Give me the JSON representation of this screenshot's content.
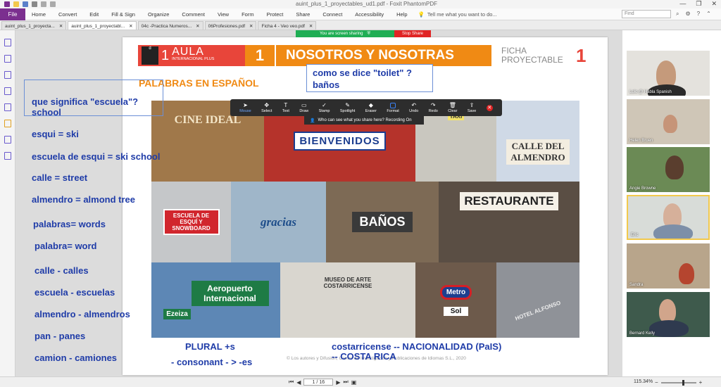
{
  "window": {
    "title": "auint_plus_1_proyectables_ud1.pdf - Foxit PhantomPDF",
    "controls": [
      "—",
      "❐",
      "✕"
    ]
  },
  "menu": {
    "file": "File",
    "items": [
      "Home",
      "Convert",
      "Edit",
      "Fill & Sign",
      "Organize",
      "Comment",
      "View",
      "Form",
      "Protect",
      "Share",
      "Connect",
      "Accessibility",
      "Help"
    ],
    "tell_me": "Tell me what you want to do...",
    "find_placeholder": "Find"
  },
  "tabs": [
    {
      "label": "auint_plus_1_proyecta...",
      "active": false
    },
    {
      "label": "auint_plus_1_proyectabl...",
      "active": true
    },
    {
      "label": "04c -Practica Numeros...",
      "active": false
    },
    {
      "label": "06Profesiones.pdf",
      "active": false
    },
    {
      "label": "Ficha 4 - Veo veo.pdf",
      "active": false
    }
  ],
  "share": {
    "status": "You are screen sharing",
    "stop_label": "Stop Share",
    "toolbar": [
      "Mouse",
      "Select",
      "Text",
      "Draw",
      "Stamp",
      "Spotlight",
      "Eraser",
      "Format",
      "Undo",
      "Redo",
      "Clear",
      "Save"
    ],
    "recording_notice": "Who can see what you share here? Recording On"
  },
  "page": {
    "banner": {
      "aula_num": "1",
      "aula_title": "AULA",
      "aula_sub": "INTERNACIONAL PLUS",
      "unit_number": "1",
      "unit_title": "NOSOTROS Y NOSOTRAS",
      "ficha_line1": "FICHA",
      "ficha_line2": "PROYECTABLE",
      "ficha_number": "1"
    },
    "section_title": "PALABRAS EN ESPAÑOL",
    "question_box": [
      "como se dice \"toilet\" ?",
      "baños"
    ],
    "footer": "© Los autores y Difusión, Centro de Investigación y Publicaciones de Idiomas S.L., 2020",
    "collage_signs": [
      "CINE IDEAL",
      "BIENVENIDOS",
      "TAXI",
      "CALLE DEL ALMENDRO",
      "ESCUELA DE ESQUÍ Y SNOWBOARD",
      "gracias",
      "BAÑOS",
      "RESTAURANTE",
      "Aeropuerto Internacional",
      "Ezeiza",
      "MUSEO DE ARTE COSTARRICENSE",
      "Metro",
      "Sol",
      "HOTEL ALFONSO"
    ]
  },
  "annotations": {
    "left": [
      "que significa \"escuela\"?",
      "school",
      "esqui = ski",
      "escuela de esqui = ski school",
      "calle = street",
      "almendro = almond tree",
      "palabras= words",
      "palabra= word",
      "calle - calles",
      "escuela - escuelas",
      "almendro - almendros",
      "pan - panes",
      "camion - camiones"
    ],
    "bottom": [
      "PLURAL +s",
      "- consonant - > -es",
      "costarricense --  NACIONALIDAD (PaIS)",
      "-- COSTA RICA"
    ]
  },
  "statusbar": {
    "page_indicator": "1 / 16",
    "zoom": "115.34%"
  },
  "participants": [
    {
      "name": "Lolo @ Habla Spanish",
      "active": false
    },
    {
      "name": "Helen Bruen",
      "active": false
    },
    {
      "name": "Angie Browne",
      "active": false
    },
    {
      "name": "Eric",
      "active": true
    },
    {
      "name": "Sandra",
      "active": false
    },
    {
      "name": "Bernard Kelly",
      "active": false
    }
  ],
  "colors": {
    "accent_orange": "#f08a14",
    "accent_red": "#e8453a",
    "annotation_blue": "#1f3ca8",
    "share_green": "#1fae54",
    "stop_red": "#e02424"
  }
}
